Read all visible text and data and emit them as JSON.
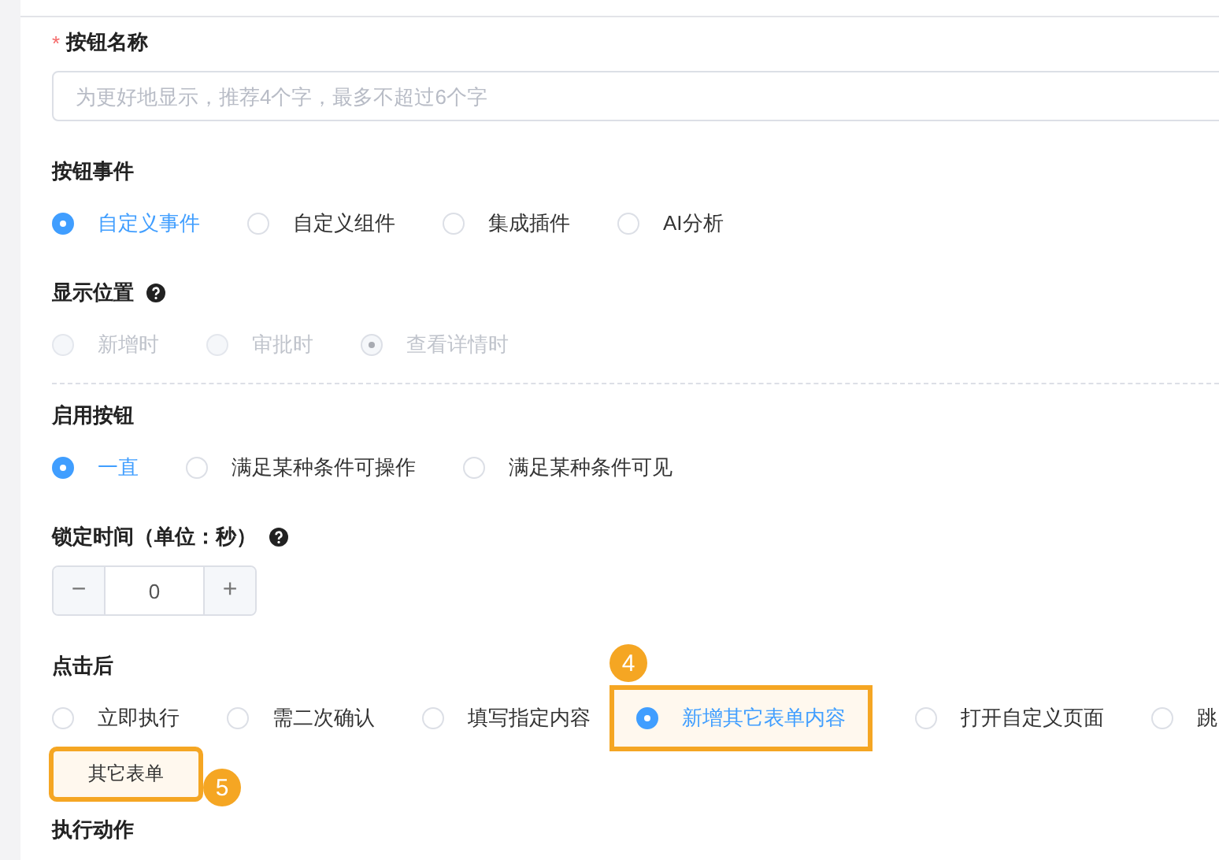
{
  "fields": [
    {
      "kind": "text",
      "label": "按钮名称",
      "required_mark": "*",
      "placeholder": "为更好地显示，推荐4个字，最多不超过6个字"
    },
    {
      "kind": "radio",
      "label": "按钮事件",
      "options": [
        {
          "label": "自定义事件",
          "selected": true
        },
        {
          "label": "自定义组件",
          "selected": false
        },
        {
          "label": "集成插件",
          "selected": false
        },
        {
          "label": "AI分析",
          "selected": false
        }
      ]
    },
    {
      "kind": "radio",
      "label": "显示位置",
      "help": true,
      "divider": true,
      "disabled": true,
      "options": [
        {
          "label": "新增时",
          "selected": false
        },
        {
          "label": "审批时",
          "selected": false
        },
        {
          "label": "查看详情时",
          "selected": true
        }
      ]
    },
    {
      "kind": "radio",
      "label": "启用按钮",
      "options": [
        {
          "label": "一直",
          "selected": true
        },
        {
          "label": "满足某种条件可操作",
          "selected": false
        },
        {
          "label": "满足某种条件可见",
          "selected": false
        }
      ]
    },
    {
      "kind": "number",
      "label": "锁定时间（单位：秒）",
      "help": true,
      "value": "0",
      "minus": "−",
      "plus": "+"
    },
    {
      "kind": "radio",
      "label": "点击后",
      "options": [
        {
          "label": "立即执行",
          "selected": false
        },
        {
          "label": "需二次确认",
          "selected": false
        },
        {
          "label": "填写指定内容",
          "selected": false
        },
        {
          "label": "新增其它表单内容",
          "selected": true,
          "marker": "4"
        },
        {
          "label": "打开自定义页面",
          "selected": false
        },
        {
          "label": "跳",
          "selected": false
        }
      ],
      "button": {
        "label": "其它表单",
        "marker": "5"
      }
    },
    {
      "kind": "heading",
      "label": "执行动作"
    }
  ]
}
